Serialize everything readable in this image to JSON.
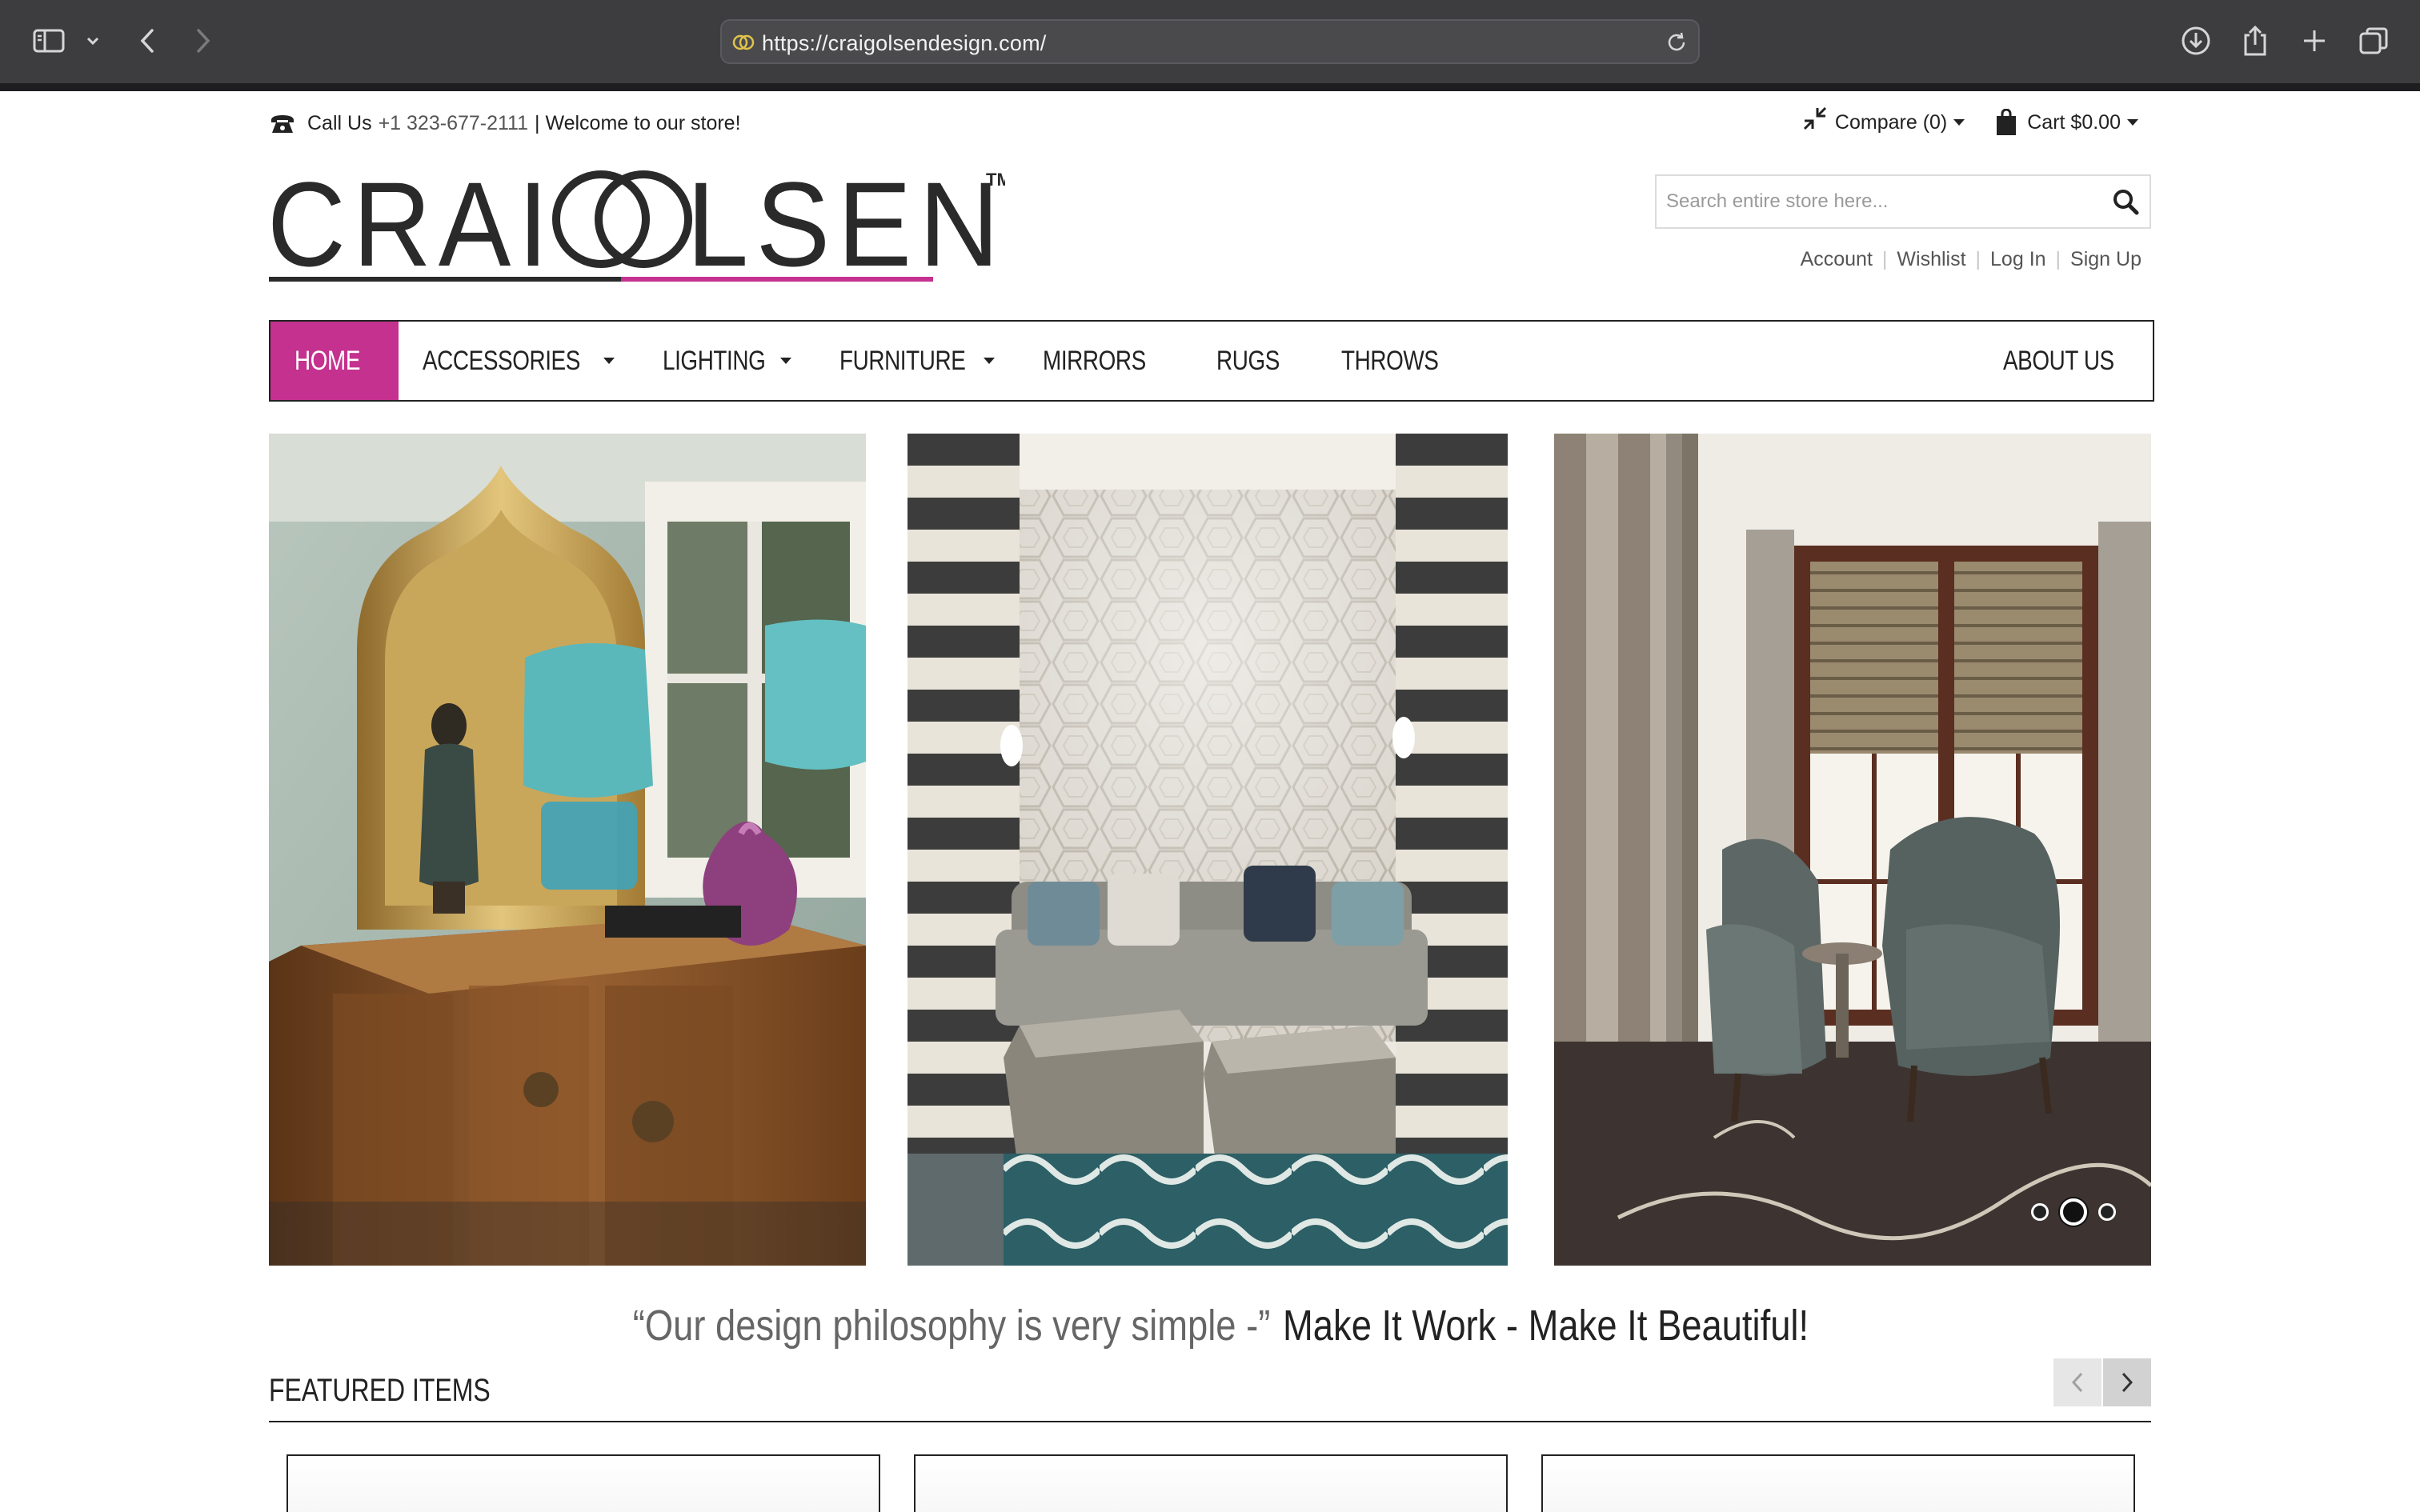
{
  "browser": {
    "url": "https://craigolsendesign.com/"
  },
  "topbar": {
    "call_label": "Call Us",
    "phone": "+1 323-677-2111",
    "welcome": "| Welcome to our store!",
    "compare_label": "Compare (0)",
    "cart_label": "Cart $0.00"
  },
  "logo": {
    "text_left": "CRAI",
    "text_right": "LSEN",
    "tm": "TM",
    "accent_color": "#c4318e"
  },
  "search": {
    "placeholder": "Search entire store here..."
  },
  "account_links": {
    "account": "Account",
    "wishlist": "Wishlist",
    "login": "Log In",
    "signup": "Sign Up"
  },
  "nav": {
    "items": [
      {
        "label": "HOME",
        "active": true
      },
      {
        "label": "ACCESSORIES",
        "dropdown": true
      },
      {
        "label": "LIGHTING",
        "dropdown": true
      },
      {
        "label": "FURNITURE",
        "dropdown": true
      },
      {
        "label": "MIRRORS"
      },
      {
        "label": "RUGS"
      },
      {
        "label": "THROWS"
      }
    ],
    "about": "ABOUT US"
  },
  "slider": {
    "dot_count": 3,
    "active_dot": 2
  },
  "tagline": {
    "quote": "“Our design philosophy is very simple -”",
    "emphasis": "Make It Work - Make It Beautiful!"
  },
  "featured": {
    "title": "FEATURED ITEMS"
  },
  "colors": {
    "brand_magenta": "#c4318e",
    "chrome_bg": "#3d3d40"
  }
}
